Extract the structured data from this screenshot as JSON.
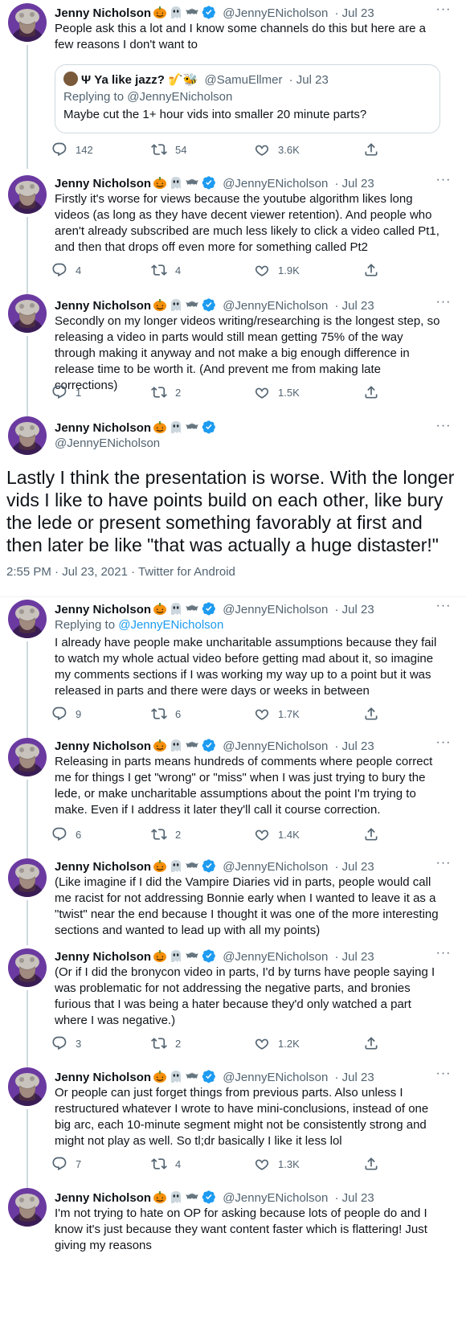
{
  "author": {
    "name": "Jenny Nicholson",
    "handle": "@JennyENicholson",
    "emoji": [
      "pumpkin",
      "ghost",
      "bat"
    ]
  },
  "tweets": [
    {
      "date": "· Jul 23",
      "text": "People ask this a lot and I know some channels do this but here are a few reasons I don't want to",
      "quote": {
        "name": "Ψ Ya like jazz? 🎷🐝",
        "handle": "@SamuEllmer",
        "date": "· Jul 23",
        "replying_prefix": "Replying to",
        "replying_to": "@JennyENicholson",
        "text": "Maybe cut the 1+ hour vids into smaller 20 minute parts?"
      },
      "replies": "142",
      "retweets": "54",
      "likes": "3.6K"
    },
    {
      "date": "· Jul 23",
      "text": "Firstly it's worse for views because the youtube algorithm likes long videos (as long as they have decent viewer retention). And people who aren't already subscribed are much less likely to click a video called Pt1, and then that drops off even more for something called Pt2",
      "replies": "4",
      "retweets": "4",
      "likes": "1.9K"
    },
    {
      "date": "· Jul 23",
      "text": "Secondly on my longer videos writing/researching is the longest step, so releasing a video in parts would still mean getting 75% of the way through making it anyway and not make a big enough difference in release time to be worth it. (And prevent me from making late corrections)",
      "replies": "1",
      "retweets": "2",
      "likes": "1.5K"
    }
  ],
  "main_tweet": {
    "text": "Lastly I think the presentation is worse. With the longer vids I like to have points build on each other, like bury the lede or present something favorably at first and then later be like \"that was actually a huge distaster!\"",
    "meta": "2:55 PM · Jul 23, 2021 · Twitter for Android"
  },
  "replies_thread": [
    {
      "date": "· Jul 23",
      "replying_prefix": "Replying to",
      "replying_to": "@JennyENicholson",
      "text": "I already have people make uncharitable assumptions because they fail to watch my whole actual video before getting mad about it, so imagine my comments sections if I was working my way up to a point but it was released in parts and there were days or weeks in between",
      "replies": "9",
      "retweets": "6",
      "likes": "1.7K"
    },
    {
      "date": "· Jul 23",
      "text": "Releasing in parts means hundreds of comments where people correct me for things I get \"wrong\" or \"miss\" when I was just trying to bury the lede, or make uncharitable assumptions about the point I'm trying to make. Even if I address it later they'll call it course correction.",
      "replies": "6",
      "retweets": "2",
      "likes": "1.4K"
    },
    {
      "date": "· Jul 23",
      "text": "(Like imagine if I did the Vampire Diaries vid in parts, people would call me racist for not addressing Bonnie early when I wanted to leave it as a \"twist\" near the end because I thought it was one of the more interesting sections and wanted to lead up with all my points)"
    },
    {
      "date": "· Jul 23",
      "text": "(Or if I did the bronycon video in parts, I'd by turns have people saying I was problematic for not addressing the negative parts, and bronies furious that I was being a hater because they'd only watched a part where I was negative.)",
      "replies": "3",
      "retweets": "2",
      "likes": "1.2K"
    },
    {
      "date": "· Jul 23",
      "text": "Or people can just forget things from previous parts. Also unless I restructured whatever I wrote to have mini-conclusions, instead of one big arc, each 10-minute segment might not be consistently strong and might not play as well. So tl;dr basically I like it less lol",
      "replies": "7",
      "retweets": "4",
      "likes": "1.3K"
    },
    {
      "date": "· Jul 23",
      "text": "I'm not trying to hate on OP for asking because lots of people do and I know it's just because they want content faster which is flattering! Just giving my reasons"
    }
  ],
  "colors": {
    "text": "#0f1419",
    "secondary": "#536471",
    "link": "#1d9bf0",
    "border": "#cfd9de",
    "verified": "#1d9bf0"
  }
}
